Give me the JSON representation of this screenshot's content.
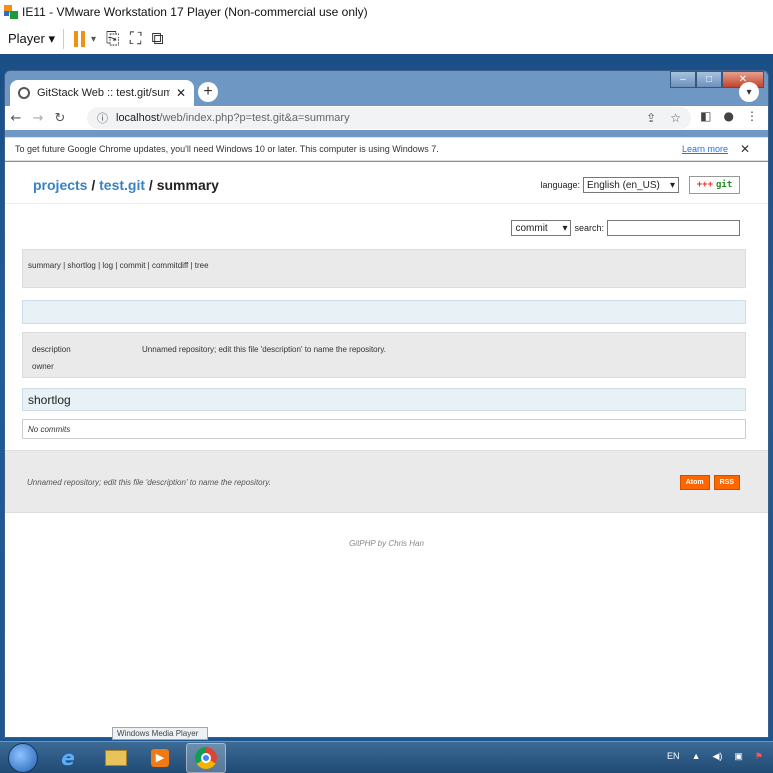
{
  "vmware": {
    "title": "IE11 - VMware Workstation 17 Player (Non-commercial use only)",
    "player_menu": "Player",
    "icons": [
      "vmware-logo-icon",
      "pause-icon",
      "send-ctrl-alt-del-icon",
      "fit-guest-icon",
      "unity-icon"
    ]
  },
  "browser": {
    "tab_title": "GitStack Web :: test.git/summary",
    "tab_close": "✕",
    "newtab": "+",
    "url_host": "localhost",
    "url_path": "/web/index.php?p=test.git&a=summary",
    "infobar_text": "To get future Google Chrome updates, you'll need Windows 10 or later. This computer is using Windows 7.",
    "infobar_link": "Learn more",
    "infobar_close": "✕"
  },
  "page": {
    "breadcrumb": {
      "projects": "projects",
      "sep1": "/",
      "repo": "test.git",
      "sep2": "/",
      "current": "summary"
    },
    "language_label": "language:",
    "language_value": "English (en_US)",
    "git_logo": "git",
    "git_logo_plus": "+++",
    "search_type": "commit",
    "search_label": "search:",
    "search_value": "",
    "nav_links": [
      "summary",
      "shortlog",
      "log",
      "commit",
      "commitdiff",
      "tree"
    ],
    "description_label": "description",
    "description_value": "Unnamed repository; edit this file 'description' to name the repository.",
    "owner_label": "owner",
    "owner_value": "",
    "shortlog_title": "shortlog",
    "no_commits": "No commits",
    "footer_desc": "Unnamed repository; edit this file 'description' to name the repository.",
    "atom": "Atom",
    "rss": "RSS",
    "credit": "GitPHP by Chris Han"
  },
  "taskbar": {
    "tooltip": "Windows Media Player",
    "tray_lang": "EN",
    "apps": [
      "ie-icon",
      "explorer-icon",
      "media-player-icon",
      "chrome-icon"
    ]
  },
  "colors": {
    "link": "#3a81c3",
    "accent_orange": "#ff6600",
    "vm_pause": "#f29111"
  }
}
